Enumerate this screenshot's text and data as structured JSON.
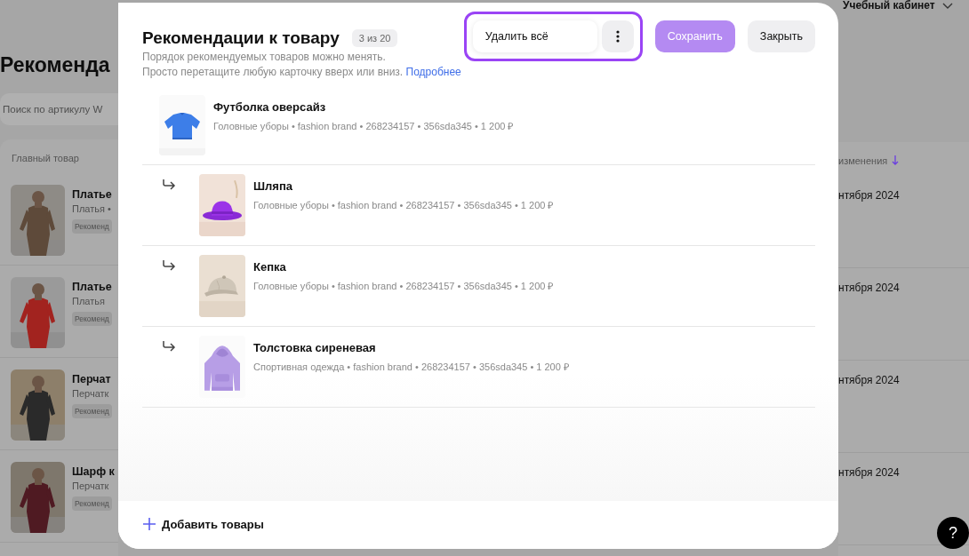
{
  "background": {
    "account": "Учебный кабинет",
    "page_title": "Рекоменда",
    "search": {
      "placeholder": "Поиск по артикулу W"
    },
    "columns": [
      "Главный товар",
      "изменения"
    ],
    "rows": [
      {
        "name": "Платье",
        "category": "Платья •",
        "tag": "Рекоменд",
        "date": "нтября 2024"
      },
      {
        "name": "Платье",
        "category": "Платья",
        "tag": "Рекоменд",
        "date": "нтября 2024"
      },
      {
        "name": "Перчат",
        "category": "Перчатк",
        "tag": "Рекоменд",
        "date": "нтября 2024"
      },
      {
        "name": "Шарф к",
        "category": "Перчатк",
        "tag": "Рекоменд",
        "date": "нтября 2024"
      }
    ]
  },
  "modal": {
    "title": "Рекомендации к товару",
    "counter": "3 из 20",
    "description": [
      "Порядок рекомендуемых товаров можно менять.",
      "Просто перетащите любую карточку вверх или вниз."
    ],
    "link": "Подробнее",
    "actions_highlighted": true,
    "delete_all": "Удалить всё",
    "save": {
      "label": "Сохранить",
      "disabled": true
    },
    "close": "Закрыть",
    "product": {
      "name": "Футболка оверсайз",
      "meta": "Головные уборы • fashion brand • 268234157 • 356sda345 • 1 200 ₽",
      "children": [
        {
          "name": "Шляпа",
          "meta": "Головные уборы • fashion brand • 268234157 • 356sda345 • 1 200 ₽"
        },
        {
          "name": "Кепка",
          "meta": "Головные уборы • fashion brand • 268234157 • 356sda345 • 1 200 ₽"
        },
        {
          "name": "Толстовка сиреневая",
          "meta": "Спортивная одежда • fashion brand • 268234157 • 356sda345 • 1 200 ₽"
        }
      ]
    },
    "add_button": "Добавить товары"
  },
  "help_button": "?"
}
